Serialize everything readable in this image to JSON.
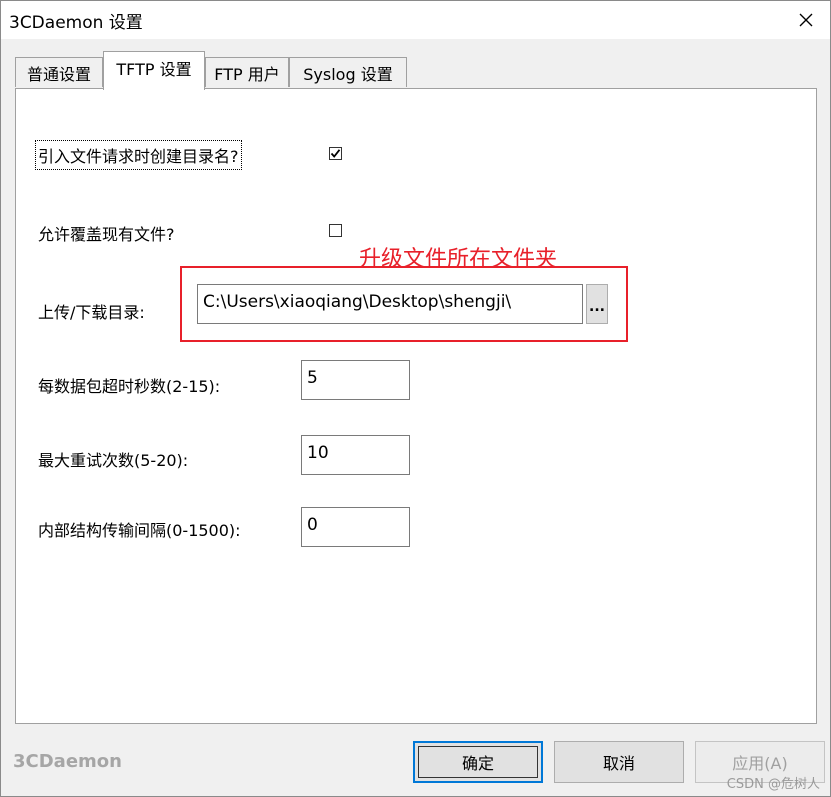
{
  "window": {
    "title": "3CDaemon 设置"
  },
  "tabs": [
    {
      "label": "普通设置"
    },
    {
      "label": "TFTP 设置"
    },
    {
      "label": "FTP 用户"
    },
    {
      "label": "Syslog 设置"
    }
  ],
  "settings": {
    "create_dir_label": "引入文件请求时创建目录名?",
    "create_dir_checked": true,
    "overwrite_label": "允许覆盖现有文件?",
    "overwrite_checked": false,
    "dir_label": "上传/下载目录:",
    "dir_value": "C:\\Users\\xiaoqiang\\Desktop\\shengji\\",
    "browse_label": "...",
    "timeout_label": "每数据包超时秒数(2-15):",
    "timeout_value": "5",
    "retries_label": "最大重试次数(5-20):",
    "retries_value": "10",
    "interval_label": "内部结构传输间隔(0-1500):",
    "interval_value": "0"
  },
  "annotation": {
    "text": "升级文件所在文件夹",
    "color": "#e8202a"
  },
  "footer": {
    "brand": "3CDaemon",
    "ok_label": "确定",
    "cancel_label": "取消",
    "apply_label": "应用(A)"
  },
  "watermark": "CSDN @危树人",
  "icons": {
    "close": "close-icon",
    "check": "checkmark-icon"
  }
}
